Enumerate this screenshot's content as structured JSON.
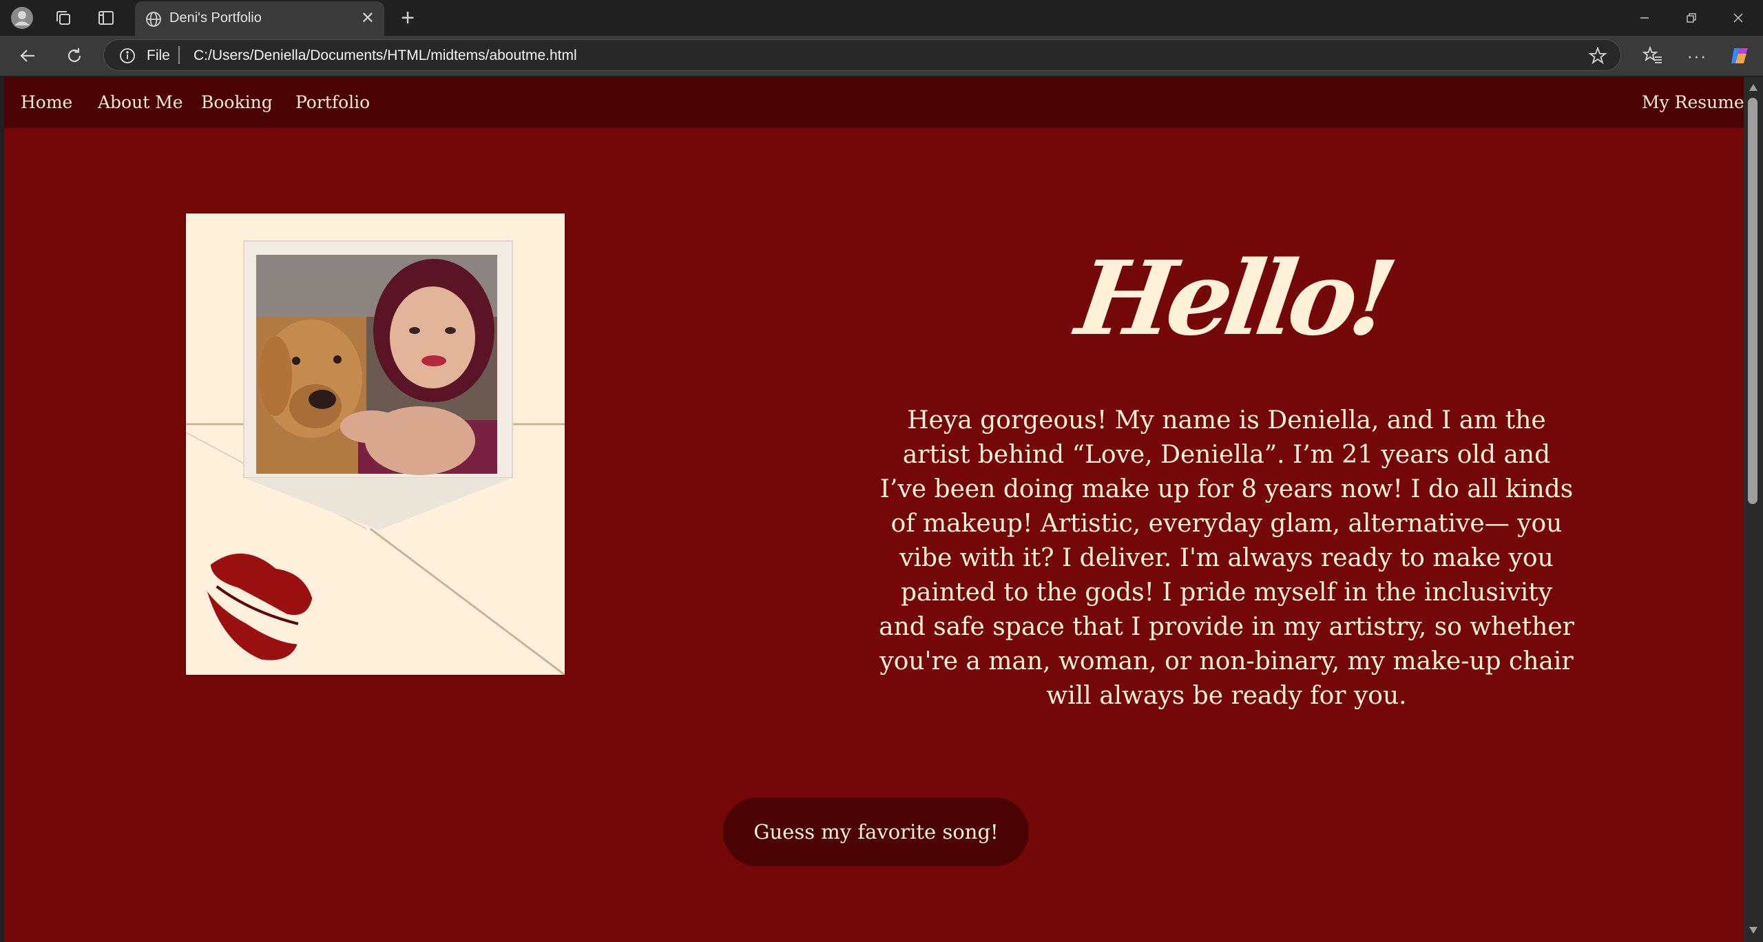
{
  "browser": {
    "tab": {
      "title": "Deni's Portfolio",
      "favicon": "globe-icon"
    },
    "address": {
      "scheme_label": "File",
      "url": "C:/Users/Deniella/Documents/HTML/midtems/aboutme.html"
    },
    "icons": [
      "profile-icon",
      "workspaces-icon",
      "tab-actions-icon",
      "back-icon",
      "refresh-icon",
      "info-icon",
      "favorite-star-icon",
      "favorites-icon",
      "more-icon",
      "copilot-icon",
      "minimize-icon",
      "restore-icon",
      "close-icon",
      "new-tab-icon"
    ]
  },
  "nav": {
    "home": "Home",
    "about": "About Me",
    "booking": "Booking",
    "portfolio": "Portfolio",
    "resume": "My Resume"
  },
  "hero": {
    "heading": "Hello!",
    "bio": "Heya gorgeous! My name is Deniella, and I am the artist behind “Love, Deniella”. I’m 21 years old and I’ve been doing make up for 8 years now! I do all kinds of makeup! Artistic, everyday glam, alternative— you vibe with it? I deliver. I'm always ready to make you painted to the gods! I pride myself in the inclusivity and safe space that I provide in my artistry, so whether you're a man, woman, or non-binary, my make-up chair will always be ready for you."
  },
  "cta": {
    "song_button": "Guess my favorite song!"
  },
  "colors": {
    "page_background": "#740707",
    "navbar": "#4a0202",
    "cream_text": "#fff0d8",
    "card": "#fff0dc",
    "lipstick": "#9a0f0f"
  }
}
